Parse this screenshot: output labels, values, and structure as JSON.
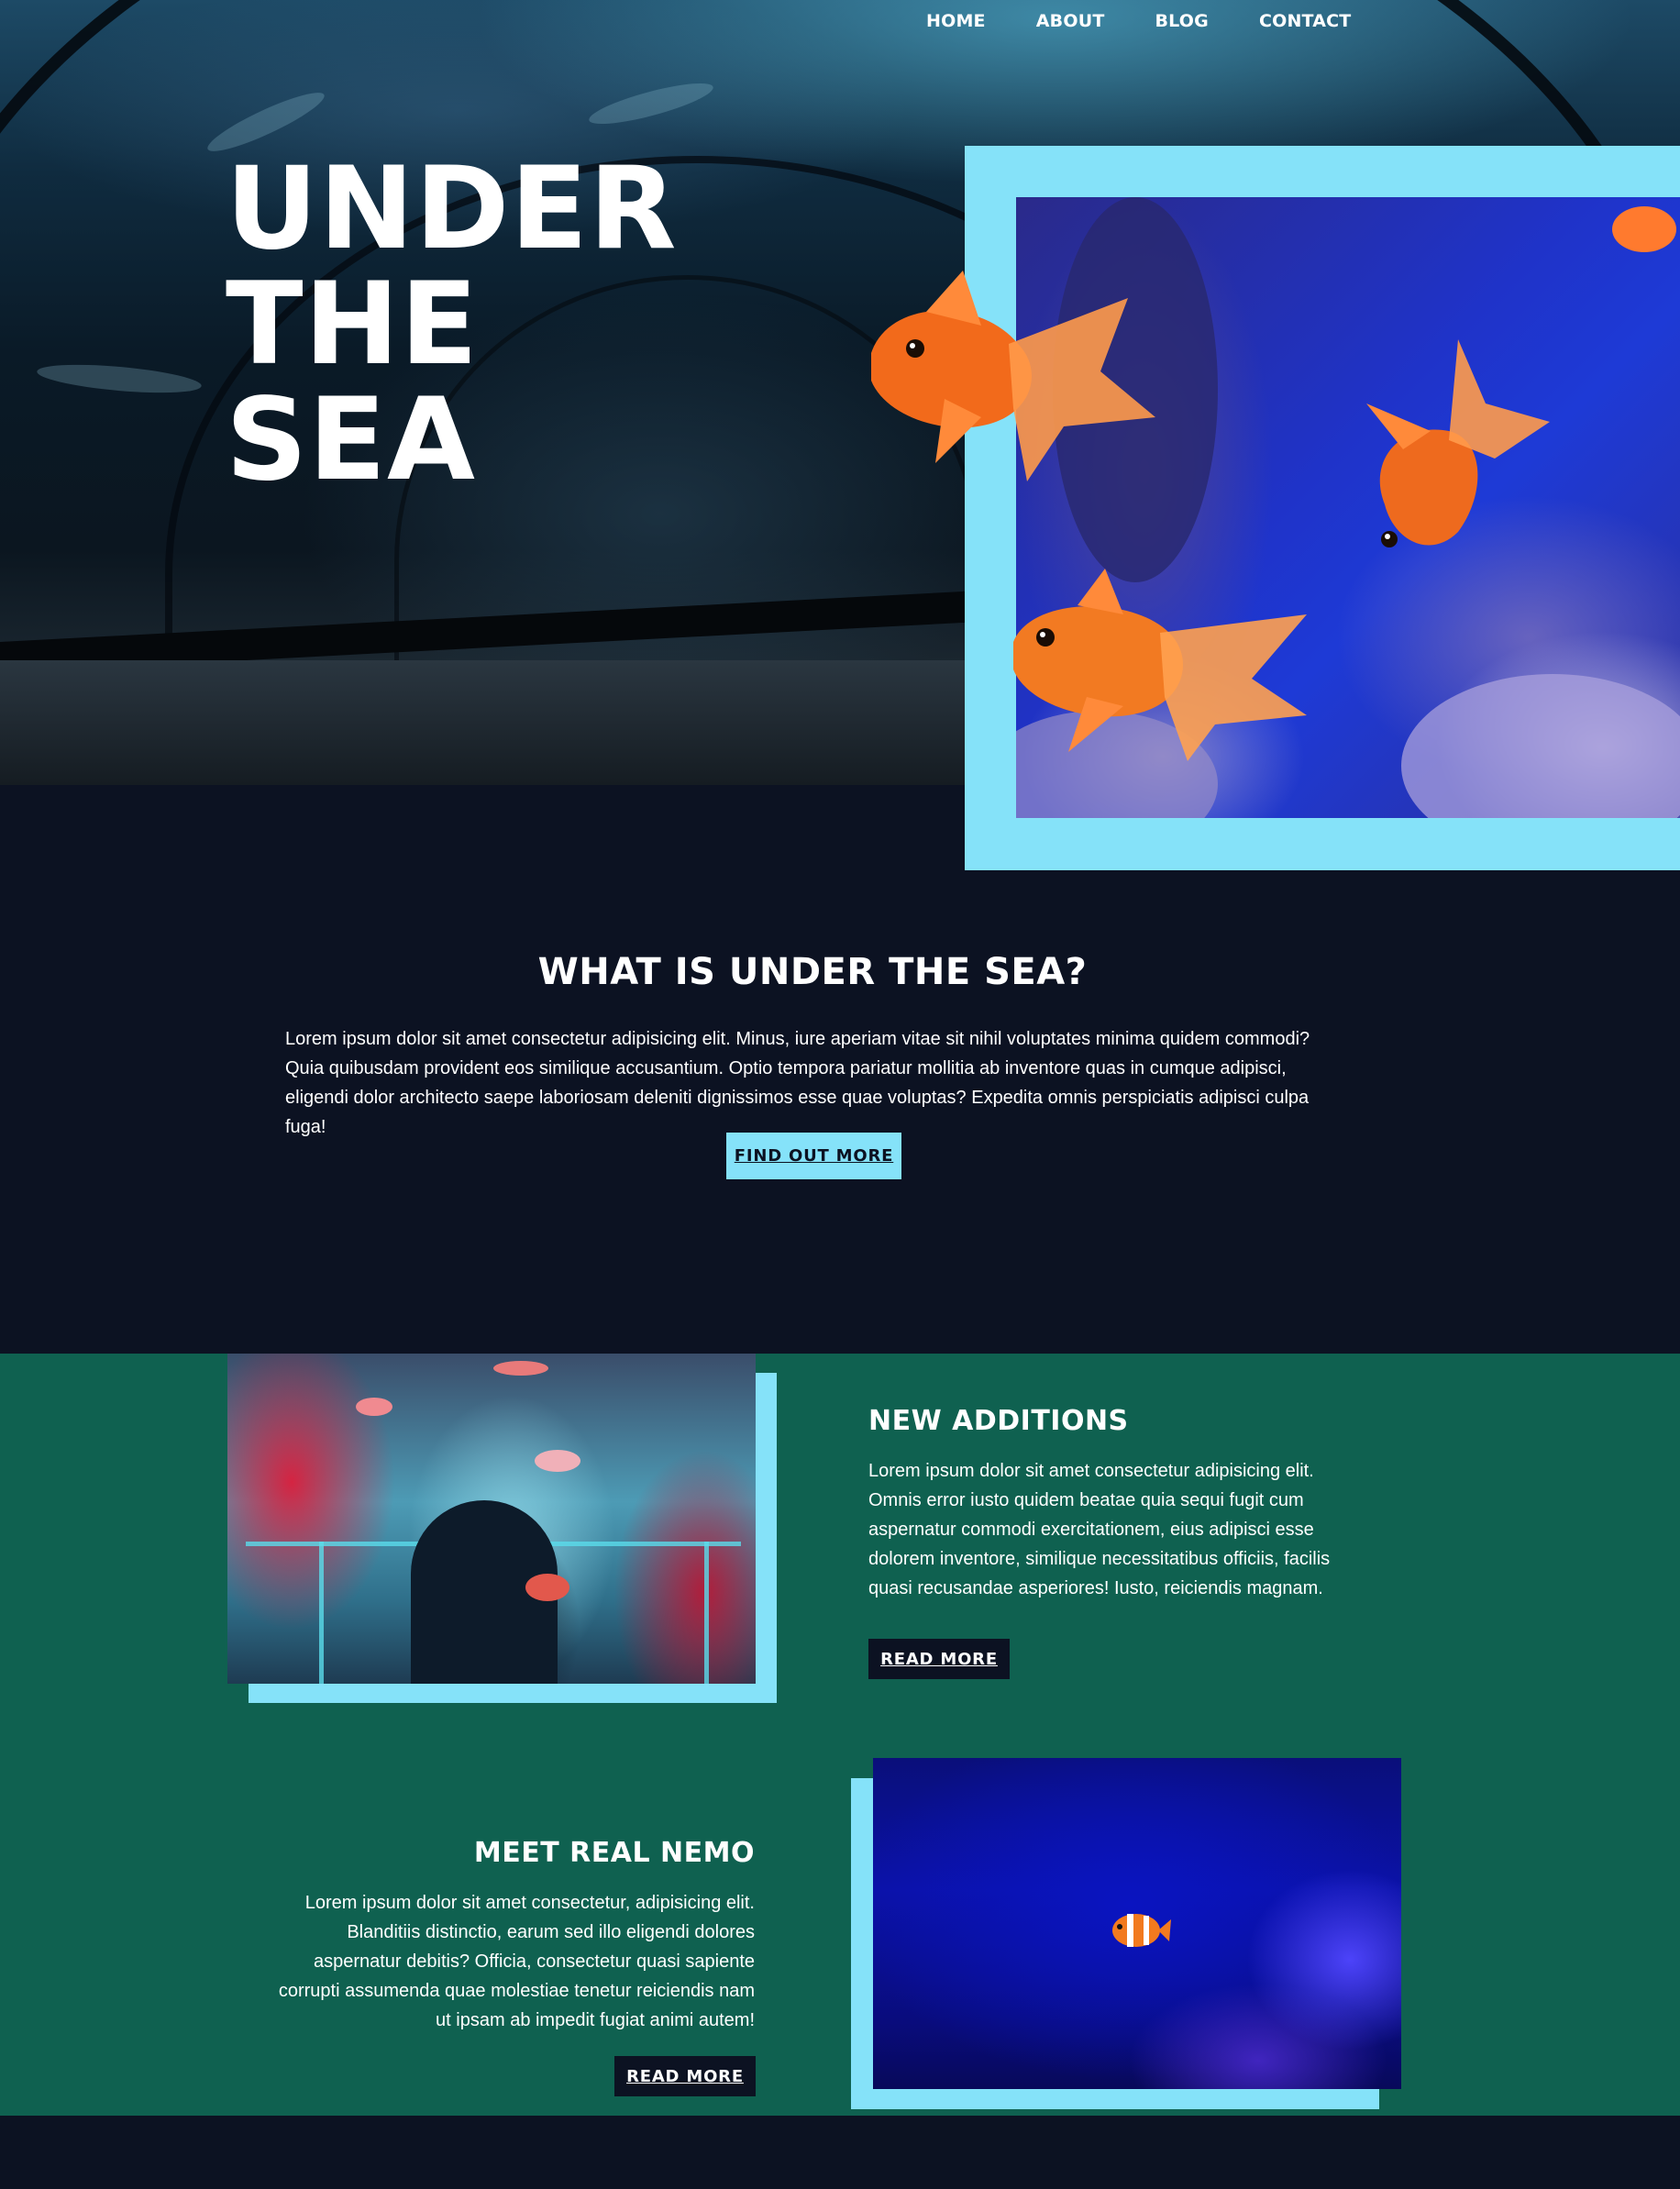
{
  "nav": {
    "items": [
      {
        "label": "HOME"
      },
      {
        "label": "ABOUT"
      },
      {
        "label": "BLOG"
      },
      {
        "label": "CONTACT"
      }
    ]
  },
  "hero": {
    "title_lines": [
      "UNDER",
      "THE",
      "SEA"
    ]
  },
  "intro": {
    "title": "WHAT IS UNDER THE SEA?",
    "body": "Lorem ipsum dolor sit amet consectetur adipisicing elit. Minus, iure aperiam vitae sit nihil voluptates minima quidem commodi? Quia quibusdam provident eos similique accusantium. Optio tempora pariatur mollitia ab inventore quas in cumque adipisci, eligendi dolor architecto saepe laboriosam deleniti dignissimos esse quae voluptas? Expedita omnis perspiciatis adipisci culpa fuga!",
    "button_label": "FIND OUT MORE"
  },
  "features": [
    {
      "title": "NEW ADDITIONS",
      "body": "Lorem ipsum dolor sit amet consectetur adipisicing elit. Omnis error iusto quidem beatae quia sequi fugit cum aspernatur commodi exercitationem, eius adipisci esse dolorem inventore, similique necessitatibus officiis, facilis quasi recusandae asperiores! Iusto, reiciendis magnam.",
      "button_label": "READ MORE"
    },
    {
      "title": "MEET REAL NEMO",
      "body": "Lorem ipsum dolor sit amet consectetur, adipisicing elit. Blanditiis distinctio, earum sed illo eligendi dolores aspernatur debitis? Officia, consectetur quasi sapiente corrupti assumenda quae molestiae tenetur reiciendis nam ut ipsam ab impedit fugiat animi autem!",
      "button_label": "READ MORE"
    }
  ],
  "colors": {
    "background": "#0c1222",
    "accent": "#85e2f9",
    "section_green": "#0f6150",
    "text": "#ffffff"
  }
}
